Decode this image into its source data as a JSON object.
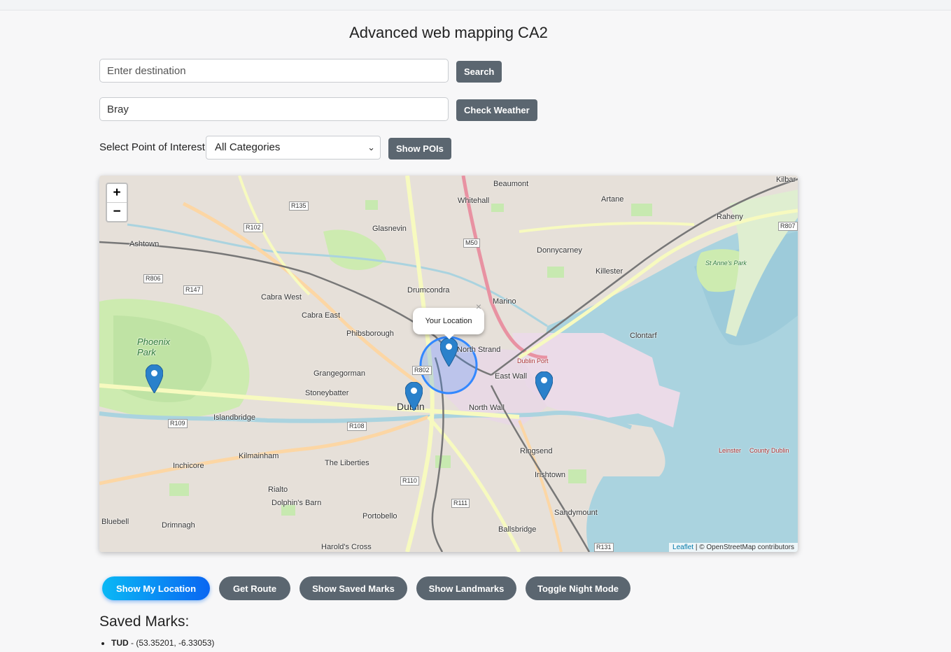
{
  "page": {
    "title": "Advanced web mapping CA2"
  },
  "search": {
    "placeholder": "Enter destination",
    "value": "",
    "button": "Search"
  },
  "weather": {
    "value": "Bray",
    "button": "Check Weather"
  },
  "poi": {
    "label": "Select Point of Interest:",
    "selected": "All Categories",
    "button": "Show POIs"
  },
  "map": {
    "zoom_in": "+",
    "zoom_out": "−",
    "attribution_link": "Leaflet",
    "attribution_text": " | © OpenStreetMap contributors",
    "popup_text": "Your Location",
    "popup_close": "×",
    "places": [
      "Beaumont",
      "Whitehall",
      "Artane",
      "Raheny",
      "Kilbar",
      "Glasnevin",
      "Ashtown",
      "Donnycarney",
      "Killester",
      "Drumcondra",
      "Cabra West",
      "Marino",
      "Cabra East",
      "Phibsborough",
      "Clontarf",
      "North Strand",
      "Phoenix Park",
      "Grangegorman",
      "East Wall",
      "Stoneybatter",
      "Dublin",
      "North Wall",
      "Islandbridge",
      "Ringsend",
      "Inchicore",
      "Kilmainham",
      "The Liberties",
      "Irishtown",
      "Rialto",
      "Dolphin's Barn",
      "Sandymount",
      "Bluebell",
      "Drimnagh",
      "Portobello",
      "Ballsbridge",
      "Harold's Cross",
      "Dublin Port",
      "St Anne's Park",
      "Leinster",
      "County Dublin"
    ],
    "roads": [
      "R135",
      "R102",
      "R806",
      "R147",
      "M50",
      "R807",
      "R802",
      "R109",
      "R108",
      "R110",
      "R111",
      "R131"
    ]
  },
  "actions": {
    "show_location": "Show My Location",
    "get_route": "Get Route",
    "show_saved": "Show Saved Marks",
    "show_landmarks": "Show Landmarks",
    "toggle_night": "Toggle Night Mode"
  },
  "saved": {
    "title": "Saved Marks:",
    "items": [
      {
        "name": "TUD",
        "coords": " - (53.35201, -6.33053)"
      }
    ]
  },
  "colors": {
    "primary_start": "#0ab8f5",
    "primary_end": "#0a66f2",
    "button_dark": "#5b6670",
    "marker": "#2a81cb"
  }
}
